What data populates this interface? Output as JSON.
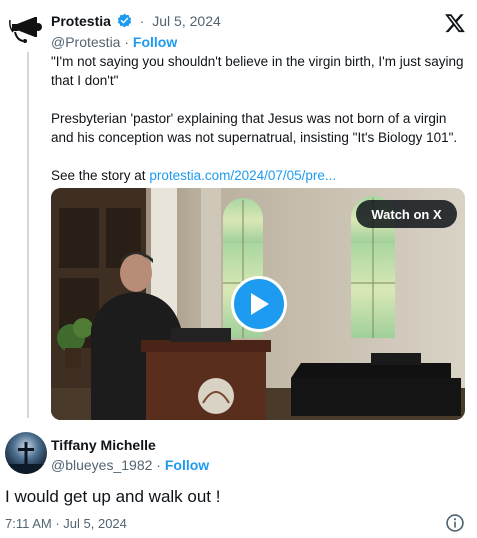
{
  "quoted_tweet": {
    "author_name": "Protestia",
    "date": "Jul 5, 2024",
    "handle": "@Protestia",
    "follow_label": "Follow",
    "text_line1": "\"I'm not saying you shouldn't believe in the virgin birth, I'm just saying that I don't\"",
    "text_line2": "Presbyterian 'pastor' explaining that Jesus was not born of a virgin and his conception was not supernatrual, insisting \"It's Biology 101\".",
    "text_link_prefix": "See the story at ",
    "text_link": "protestia.com/2024/07/05/pre...",
    "video": {
      "watch_label": "Watch on X"
    }
  },
  "reply": {
    "author_name": "Tiffany Michelle",
    "handle": "@blueyes_1982",
    "follow_label": "Follow",
    "text": "I would get up and walk out !",
    "timestamp": "7:11 AM · Jul 5, 2024"
  },
  "colors": {
    "accent": "#1d9bf0",
    "text": "#0f1419",
    "secondary": "#536471",
    "thread_line": "#cfd9de"
  },
  "icons": [
    "protestia-logo-icon",
    "verified-badge-icon",
    "x-logo-icon",
    "play-icon",
    "info-icon"
  ]
}
